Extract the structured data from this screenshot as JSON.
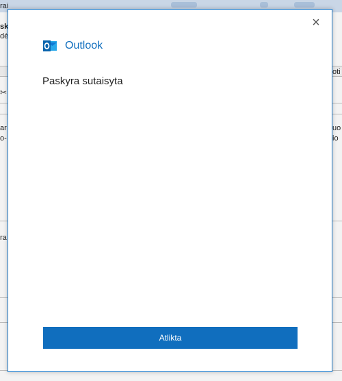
{
  "background": {
    "fragments": {
      "top_left_1": "rai",
      "top_left_2": "sky",
      "top_left_3": "dė",
      "row_left_1": "ar",
      "row_left_2": "o-",
      "row_left_3": "ra",
      "row_right_1": "oti",
      "row_right_2": "uo",
      "row_right_3": "io"
    }
  },
  "dialog": {
    "brand": {
      "name": "Outlook",
      "logo_icon": "outlook-logo-icon"
    },
    "status_text": "Paskyra sutaisyta",
    "done_button_label": "Atlikta",
    "close_icon": "close-icon"
  },
  "colors": {
    "accent": "#106ebe",
    "dialog_border": "#1979ca",
    "button_text": "#ffffff"
  }
}
